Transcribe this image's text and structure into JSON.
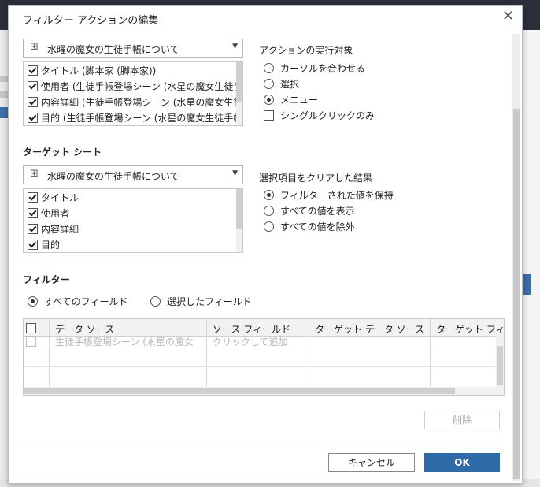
{
  "dialog": {
    "title": "フィルター アクションの編集"
  },
  "source": {
    "sheet_select": "水曜の魔女の生徒手帳について",
    "fields": [
      {
        "label": "タイトル (脚本家 (脚本家))",
        "checked": true
      },
      {
        "label": "使用者 (生徒手帳登場シーン (水星の魔女生徒手",
        "checked": true
      },
      {
        "label": "内容詳細 (生徒手帳登場シーン (水星の魔女生徒手",
        "checked": true
      },
      {
        "label": "目的 (生徒手帳登場シーン (水星の魔女生徒手帳",
        "checked": true
      }
    ]
  },
  "run_action": {
    "heading": "アクションの実行対象",
    "options": [
      {
        "label": "カーソルを合わせる",
        "selected": false
      },
      {
        "label": "選択",
        "selected": false
      },
      {
        "label": "メニュー",
        "selected": true
      }
    ],
    "single_click": {
      "label": "シングルクリックのみ",
      "checked": false
    }
  },
  "target": {
    "heading": "ターゲット シート",
    "sheet_select": "水曜の魔女の生徒手帳について",
    "fields": [
      {
        "label": "タイトル",
        "checked": true
      },
      {
        "label": "使用者",
        "checked": true
      },
      {
        "label": "内容詳細",
        "checked": true
      },
      {
        "label": "目的",
        "checked": true
      }
    ]
  },
  "clear_selection": {
    "heading": "選択項目をクリアした結果",
    "options": [
      {
        "label": "フィルターされた値を保持",
        "selected": true
      },
      {
        "label": "すべての値を表示",
        "selected": false
      },
      {
        "label": "すべての値を除外",
        "selected": false
      }
    ]
  },
  "filters": {
    "heading": "フィルター",
    "scope": [
      {
        "label": "すべてのフィールド",
        "selected": true
      },
      {
        "label": "選択したフィールド",
        "selected": false
      }
    ],
    "columns": [
      "データ ソース",
      "ソース フィールド",
      "ターゲット データ ソース",
      "ターゲット フィ"
    ],
    "placeholder_row": {
      "data_source": "生徒手帳登場シーン (水星の魔女",
      "source_field": "クリックして追加"
    }
  },
  "buttons": {
    "delete": "削除",
    "cancel": "キャンセル",
    "ok": "OK"
  }
}
